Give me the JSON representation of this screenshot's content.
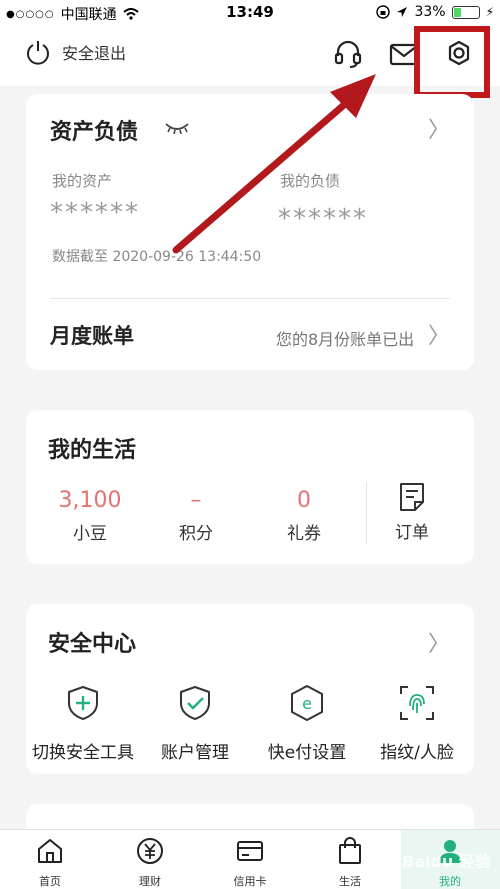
{
  "status_bar": {
    "carrier": "中国联通",
    "time": "13:49",
    "battery": "33%",
    "battery_level": 0.33
  },
  "header": {
    "logout_label": "安全退出"
  },
  "assets_card": {
    "title": "资产负债",
    "my_assets_label": "我的资产",
    "my_assets_value": "******",
    "my_debts_label": "我的负债",
    "my_debts_value": "******",
    "data_time": "数据截至  2020-09-26 13:44:50",
    "monthly_title": "月度账单",
    "monthly_note": "您的8月份账单已出"
  },
  "life_card": {
    "title": "我的生活",
    "stats": [
      {
        "value": "3,100",
        "label": "小豆"
      },
      {
        "value": "–",
        "label": "积分"
      },
      {
        "value": "0",
        "label": "礼券"
      }
    ],
    "order_label": "订单"
  },
  "security_card": {
    "title": "安全中心",
    "items": [
      {
        "label": "切换安全工具",
        "icon": "shield-plus-icon"
      },
      {
        "label": "账户管理",
        "icon": "shield-check-icon"
      },
      {
        "label": "快e付设置",
        "icon": "hexagon-e-icon"
      },
      {
        "label": "指纹/人脸",
        "icon": "fingerprint-icon"
      }
    ]
  },
  "tabbar": {
    "tabs": [
      {
        "label": "首页",
        "icon": "home-icon"
      },
      {
        "label": "理财",
        "icon": "yuan-icon"
      },
      {
        "label": "信用卡",
        "icon": "credit-card-icon"
      },
      {
        "label": "生活",
        "icon": "shopping-bag-icon"
      },
      {
        "label": "我的",
        "icon": "profile-icon"
      }
    ],
    "active_index": 4
  },
  "watermark": "Baidu 经验",
  "colors": {
    "accent": "#22b07d",
    "highlight": "#c0191c",
    "value_red": "#e57373"
  }
}
